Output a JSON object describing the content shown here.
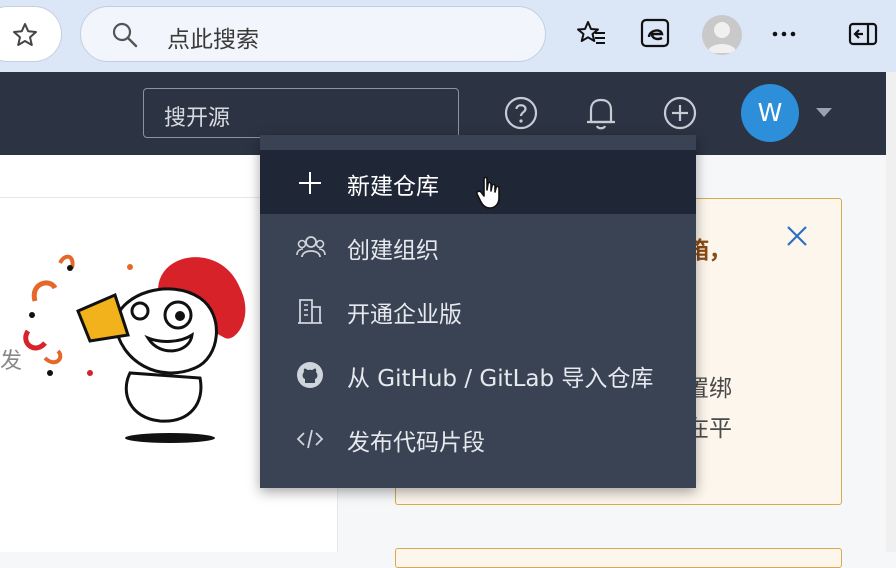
{
  "browser": {
    "address_placeholder": "点此搜索",
    "icons": [
      "star-icon",
      "search-icon",
      "favorites-icon",
      "edge-icon",
      "profile-icon",
      "more-icon",
      "sidebar-icon"
    ],
    "more_label": "···"
  },
  "header": {
    "search_placeholder": "搜开源",
    "icons": [
      "help-icon",
      "bell-icon",
      "plus-circle-icon",
      "chevron-down-icon"
    ],
    "avatar_letter": "W",
    "avatar_color": "#2d8fd9"
  },
  "left_panel": {
    "partial_text": "发"
  },
  "notice": {
    "title_fragment": "箱，",
    "line1_fragment": "置绑",
    "line2_fragment": "在平"
  },
  "dropdown": {
    "items": [
      {
        "label": "新建仓库",
        "icon": "plus-icon",
        "highlighted": true
      },
      {
        "label": "创建组织",
        "icon": "group-icon",
        "highlighted": false
      },
      {
        "label": "开通企业版",
        "icon": "building-icon",
        "highlighted": false
      },
      {
        "label": "从 GitHub / GitLab 导入仓库",
        "icon": "github-icon",
        "highlighted": false
      },
      {
        "label": "发布代码片段",
        "icon": "code-icon",
        "highlighted": false
      }
    ]
  },
  "colors": {
    "nav_bg": "#2c3342",
    "menu_bg": "#3a4353",
    "menu_highlight": "#1f2737",
    "notice_border": "#d9a94a",
    "notice_bg": "#fdf6ec"
  }
}
